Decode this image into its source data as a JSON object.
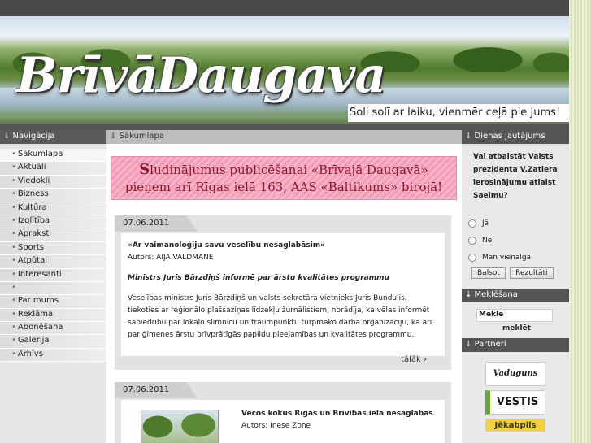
{
  "header": {
    "logo_word1": "Brīvā",
    "logo_word2": "Daugava",
    "slogan": "Soli solī ar laiku, vienmēr ceļā pie Jums!"
  },
  "nav": {
    "title": "↓ Navigācija",
    "items": [
      {
        "label": "Sākumlapa"
      },
      {
        "label": "Aktuāli"
      },
      {
        "label": "Viedokļi"
      },
      {
        "label": "Bizness"
      },
      {
        "label": "Kultūra"
      },
      {
        "label": "Izglītība"
      },
      {
        "label": "Apraksti"
      },
      {
        "label": "Sports"
      },
      {
        "label": "Atpūtai"
      },
      {
        "label": "Interesanti"
      },
      {
        "label": ""
      },
      {
        "label": "Par mums"
      },
      {
        "label": "Reklāma"
      },
      {
        "label": "Abonēšana"
      },
      {
        "label": "Galerija"
      },
      {
        "label": "Arhīvs"
      }
    ],
    "bullet": "•"
  },
  "main": {
    "title": "↓ Sākumlapa",
    "ad": {
      "line1_first": "S",
      "line1_rest": "ludinājumus publicēšanai «Brīvajā Daugavā»",
      "line2": "pieņem arī Rīgas ielā 163, AAS «Baltikums» birojā!"
    },
    "posts": [
      {
        "date": "07.06.2011",
        "title": "«Ar vaimanoloģiju savu veselību nesaglabāsim»",
        "author": "Autors: AIJA VALDMANE",
        "lead": "Ministrs Juris Bārzdiņš informē par ārstu kvalitātes programmu",
        "text": "Veselības ministrs Juris Bārzdiņš un valsts sekretāra vietnieks Juris Bundulis, tiekoties ar reģionālo plašsaziņas līdzekļu žurnālistiem, norādīja, ka vēlas informēt sabiedrību par lokālo slimnīcu un traumpunktu turpmāko darba organizāciju, kā arī par ģimenes ārstu brīvprātīgās papildu pieejamības un kvalitātes programmu.",
        "more": "tālāk ›"
      },
      {
        "date": "07.06.2011",
        "title": "Vecos kokus Rīgas un Brīvības ielā nesaglabās",
        "author": "Autors: Inese Zone"
      }
    ]
  },
  "poll": {
    "title": "↓ Dienas jautājums",
    "question": "Vai atbalstāt Valsts prezidenta V.Zatlera ierosinājumu atlaist Saeimu?",
    "options": [
      "Jā",
      "Nē",
      "Man vienalga"
    ],
    "vote_label": "Balsot",
    "results_label": "Rezultāti"
  },
  "search": {
    "title": "↓ Meklēšana",
    "value": "Meklē",
    "button": "meklēt"
  },
  "partners": {
    "title": "↓ Partneri",
    "items": [
      "Vaduguns",
      "VESTIS",
      "Jēkabpils"
    ]
  }
}
